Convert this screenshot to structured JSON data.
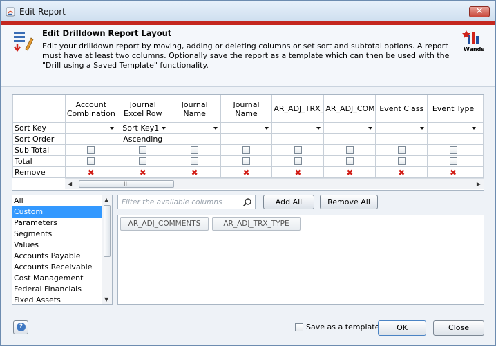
{
  "window": {
    "title": "Edit Report",
    "close_label": "✕"
  },
  "header": {
    "title": "Edit Drilldown Report Layout",
    "description": "Edit your drilldown report by moving, adding or deleting columns or set sort and subtotal options. A report must have at least two columns. Optionally save the report as a template which can then be used with the \"Drill using a Saved Template\" functionality.",
    "logo_text": "Wands"
  },
  "grid": {
    "columns": [
      "Account Combination",
      "Journal Excel Row",
      "Journal Name",
      "Journal Name",
      "AR_ADJ_TRX_T",
      "AR_ADJ_COMM",
      "Event Class",
      "Event Type"
    ],
    "row_labels": {
      "sort_key": "Sort Key",
      "sort_order": "Sort Order",
      "sub_total": "Sub Total",
      "total": "Total",
      "remove": "Remove"
    },
    "sort_keys": [
      "",
      "Sort Key1",
      "",
      "",
      "",
      "",
      "",
      ""
    ],
    "sort_orders": [
      "",
      "Ascending",
      "",
      "",
      "",
      "",
      "",
      ""
    ],
    "remove_symbol": "✖",
    "scroll_left": "◀",
    "scroll_right": "▶",
    "scroll_grip": "|||"
  },
  "categories": {
    "items": [
      "All",
      "Custom",
      "Parameters",
      "Segments",
      "Values",
      "Accounts Payable",
      "Accounts Receivable",
      "Cost Management",
      "Federal Financials",
      "Fixed Assets"
    ],
    "selected": "Custom",
    "scroll_up": "▲",
    "scroll_down": "▼"
  },
  "filter": {
    "placeholder": "Filter the available columns"
  },
  "buttons": {
    "add_all": "Add All",
    "remove_all": "Remove All",
    "ok": "OK",
    "close": "Close"
  },
  "available_columns": [
    "AR_ADJ_COMMENTS",
    "AR_ADJ_TRX_TYPE"
  ],
  "footer": {
    "help_symbol": "?",
    "save_template_label": "Save as a template"
  },
  "colors": {
    "accent_red": "#c4271f",
    "selection_blue": "#3399ff",
    "remove_red": "#d11b14"
  }
}
